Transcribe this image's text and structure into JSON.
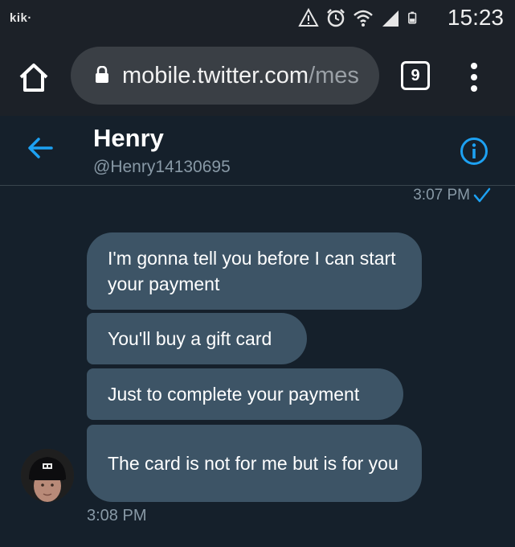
{
  "status_bar": {
    "app_label": "kik·",
    "time": "15:23",
    "icons": [
      "warning-icon",
      "alarm-icon",
      "wifi-icon",
      "signal-icon",
      "battery-icon"
    ]
  },
  "browser": {
    "url_host": "mobile.twitter.com",
    "url_path": "/mes",
    "tab_count": "9"
  },
  "conversation": {
    "name": "Henry",
    "handle": "@Henry14130695"
  },
  "messages": {
    "sent_time": "3:07 PM",
    "received": [
      "I'm gonna tell you before I can start your payment",
      "You'll buy a gift card",
      "Just to complete your payment",
      "The card is not for me but is for you"
    ],
    "received_time": "3:08 PM"
  },
  "colors": {
    "background": "#15202b",
    "bubble": "#3d5466",
    "accent": "#1da1f2",
    "muted_text": "#8899a6"
  }
}
